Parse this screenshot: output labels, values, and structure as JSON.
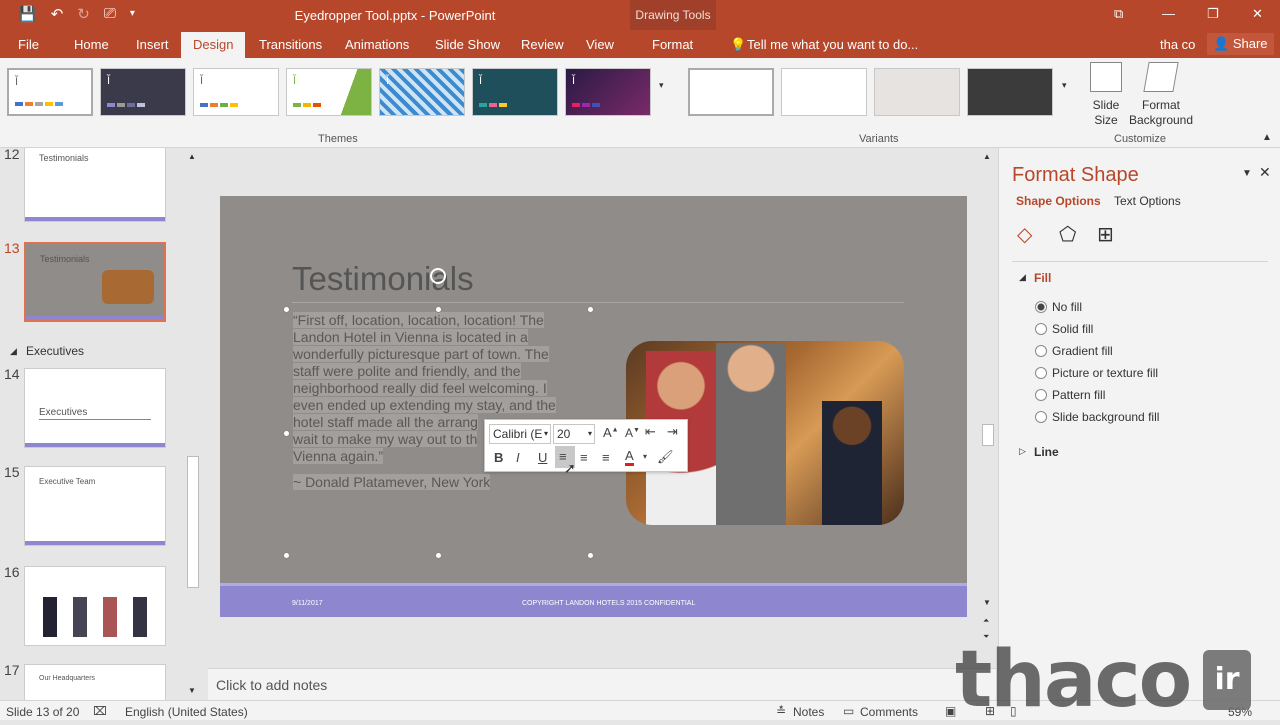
{
  "window": {
    "title": "Eyedropper Tool.pptx - PowerPoint",
    "context_tab_group": "Drawing Tools",
    "user": "tha co",
    "share": "Share",
    "tell_me": "Tell me what you want to do..."
  },
  "tabs": [
    "File",
    "Home",
    "Insert",
    "Design",
    "Transitions",
    "Animations",
    "Slide Show",
    "Review",
    "View",
    "Format"
  ],
  "ribbon": {
    "themes_label": "Themes",
    "variants_label": "Variants",
    "customize_label": "Customize",
    "theme_thumb_text": "Ĭ",
    "slide_size": "Slide Size",
    "format_background": "Format Background"
  },
  "slides_pane": {
    "section": "Executives",
    "items": [
      {
        "num": "12",
        "title": "Testimonials"
      },
      {
        "num": "13",
        "title": "Testimonials"
      },
      {
        "num": "14",
        "title": "Executives"
      },
      {
        "num": "15",
        "title": "Executive Team"
      },
      {
        "num": "16",
        "title": ""
      },
      {
        "num": "17",
        "title": "Our Headquarters"
      }
    ]
  },
  "slide": {
    "title": "Testimonials",
    "quote_lines": [
      "“First off, location, location, location!  The",
      "Landon Hotel in Vienna is located in a",
      "wonderfully picturesque part of town.  The",
      "staff were polite and friendly, and the",
      "neighborhood really did feel welcoming.  I",
      "even ended up extending my stay, and the",
      "hotel staff made all the arrang",
      "wait to make my way out to th",
      "Vienna again.”"
    ],
    "attribution": "~ Donald Platamever, New York",
    "footer_date": "9/11/2017",
    "footer_copyright": "COPYRIGHT LANDON HOTELS 2015 CONFIDENTIAL"
  },
  "mini_toolbar": {
    "font_name": "Calibri (E",
    "font_size": "20",
    "bold": "B",
    "italic": "I",
    "underline": "U",
    "font_color_glyph": "A"
  },
  "notes_placeholder": "Click to add notes",
  "format_pane": {
    "title": "Format Shape",
    "tab_shape": "Shape Options",
    "tab_text": "Text Options",
    "fill_header": "Fill",
    "fill_options": [
      "No fill",
      "Solid fill",
      "Gradient fill",
      "Picture or texture fill",
      "Pattern fill",
      "Slide background fill"
    ],
    "selected_fill": "No fill",
    "line_header": "Line"
  },
  "status": {
    "slide_info": "Slide 13 of 20",
    "language": "English (United States)",
    "notes": "Notes",
    "comments": "Comments",
    "zoom": "59%"
  },
  "watermark": {
    "text": "thaco",
    "box": "ir"
  },
  "colors": {
    "accent": "#b7472a",
    "slide_footer": "#8e87cf"
  }
}
